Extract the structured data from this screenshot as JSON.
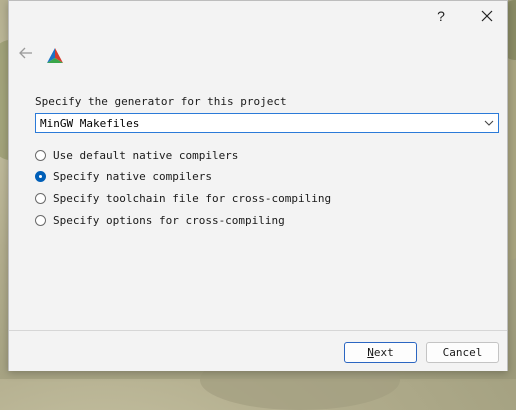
{
  "window": {
    "help_label": "?",
    "close_icon": "close-icon",
    "back_icon": "back-arrow-icon",
    "logo_icon": "cmake-logo-icon"
  },
  "generator": {
    "prompt": "Specify the generator for this project",
    "selected": "MinGW Makefiles"
  },
  "options": [
    {
      "label": "Use default native compilers",
      "checked": false
    },
    {
      "label": "Specify native compilers",
      "checked": true
    },
    {
      "label": "Specify toolchain file for cross-compiling",
      "checked": false
    },
    {
      "label": "Specify options for cross-compiling",
      "checked": false
    }
  ],
  "buttons": {
    "next_accel": "N",
    "next_rest": "ext",
    "cancel": "Cancel"
  },
  "colors": {
    "accent": "#005fb8",
    "combo_border": "#2b7ad8"
  }
}
